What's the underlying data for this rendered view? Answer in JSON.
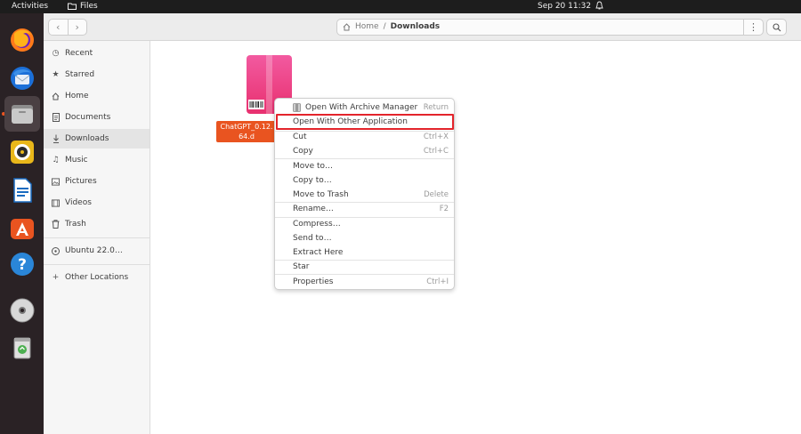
{
  "topbar": {
    "activities": "Activities",
    "app_name": "Files",
    "clock": "Sep 20  11:32"
  },
  "dock": {
    "apps": [
      "firefox-icon",
      "thunderbird-icon",
      "files-icon",
      "rhythmbox-icon",
      "writer-icon",
      "app-center-icon",
      "help-icon",
      "disc-icon",
      "trash-icon"
    ]
  },
  "header": {
    "breadcrumb_home": "Home",
    "breadcrumb_separator": "/",
    "breadcrumb_current": "Downloads"
  },
  "sidebar": {
    "items": [
      {
        "label": "Recent"
      },
      {
        "label": "Starred"
      },
      {
        "label": "Home"
      },
      {
        "label": "Documents"
      },
      {
        "label": "Downloads"
      },
      {
        "label": "Music"
      },
      {
        "label": "Pictures"
      },
      {
        "label": "Videos"
      },
      {
        "label": "Trash"
      }
    ],
    "mount": "Ubuntu 22.0…",
    "other_locations": "Other Locations"
  },
  "file": {
    "label_line1": "ChatGPT_0.12.",
    "label_line2": "64.d",
    "accent": "#e95420"
  },
  "context_menu": {
    "items": [
      {
        "label": "Open With Archive Manager",
        "accel": "Return"
      },
      {
        "label": "Open With Other Application",
        "accel": ""
      },
      {
        "label": "Cut",
        "accel": "Ctrl+X"
      },
      {
        "label": "Copy",
        "accel": "Ctrl+C"
      },
      {
        "label": "Move to…",
        "accel": ""
      },
      {
        "label": "Copy to…",
        "accel": ""
      },
      {
        "label": "Move to Trash",
        "accel": "Delete"
      },
      {
        "label": "Rename…",
        "accel": "F2"
      },
      {
        "label": "Compress…",
        "accel": ""
      },
      {
        "label": "Send to…",
        "accel": ""
      },
      {
        "label": "Extract Here",
        "accel": ""
      },
      {
        "label": "Star",
        "accel": ""
      },
      {
        "label": "Properties",
        "accel": "Ctrl+I"
      }
    ],
    "highlight_color": "#e3242b"
  }
}
